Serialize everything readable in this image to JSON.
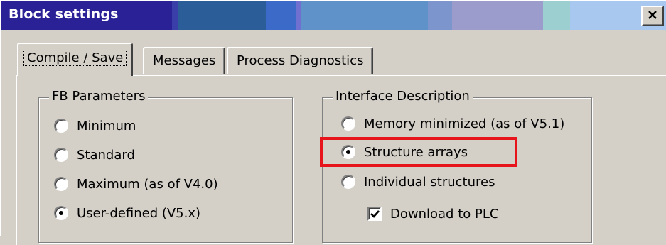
{
  "window": {
    "title": "Block settings"
  },
  "titlebar": {
    "bands": [
      "#2a2196",
      "#3a3ea8",
      "#2b5d98",
      "#3b6ac8",
      "#5f92c9",
      "#7c96cd",
      "#9c9ccc",
      "#9ccfd0",
      "#a8c8f0"
    ],
    "close_label": "close"
  },
  "tabs": [
    {
      "label": "Compile / Save",
      "active": true
    },
    {
      "label": "Messages",
      "active": false
    },
    {
      "label": "Process Diagnostics",
      "active": false
    }
  ],
  "fb_parameters": {
    "title": "FB Parameters",
    "options": [
      {
        "label": "Minimum",
        "checked": false
      },
      {
        "label": "Standard",
        "checked": false
      },
      {
        "label": "Maximum (as of V4.0)",
        "checked": false
      },
      {
        "label": "User-defined (V5.x)",
        "checked": true
      }
    ]
  },
  "interface_description": {
    "title": "Interface Description",
    "options": [
      {
        "label": "Memory minimized (as of V5.1)",
        "checked": false
      },
      {
        "label": "Structure arrays",
        "checked": true
      },
      {
        "label": "Individual structures",
        "checked": false
      }
    ],
    "download_checkbox": {
      "label": "Download to PLC",
      "checked": true
    }
  },
  "annotation": {
    "highlight_color": "#e8141c"
  }
}
